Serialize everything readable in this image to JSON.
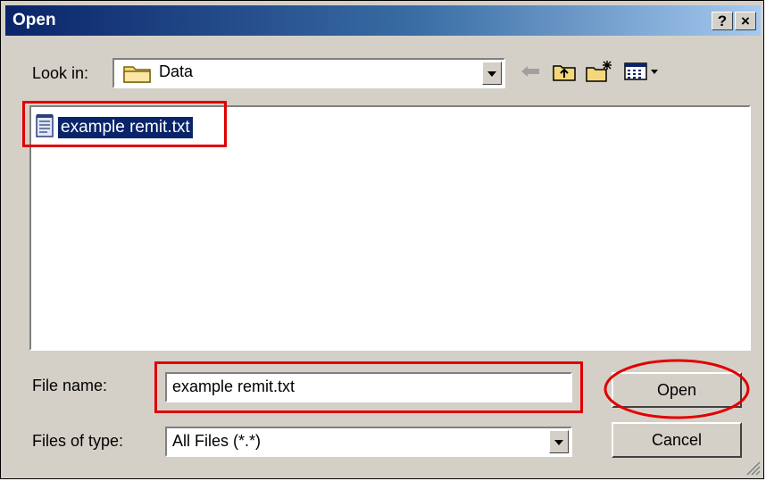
{
  "window": {
    "title": "Open",
    "help_label": "?",
    "close_label": "×"
  },
  "look_in": {
    "label": "Look in:",
    "value": "Data"
  },
  "files": [
    {
      "name": "example remit.txt",
      "selected": true,
      "icon": "text-file-icon"
    }
  ],
  "file_name": {
    "label": "File name:",
    "value": "example remit.txt"
  },
  "files_of_type": {
    "label": "Files of type:",
    "value": "All Files (*.*)"
  },
  "buttons": {
    "open": "Open",
    "cancel": "Cancel"
  },
  "toolbar": {
    "icons": [
      "back-arrow-icon",
      "up-folder-icon",
      "new-folder-icon",
      "view-menu-icon"
    ]
  },
  "colors": {
    "title_start": "#0a246a",
    "title_end": "#a6caf0",
    "selection": "#0a246a",
    "highlight": "#e00000",
    "face": "#d4d0c8"
  }
}
